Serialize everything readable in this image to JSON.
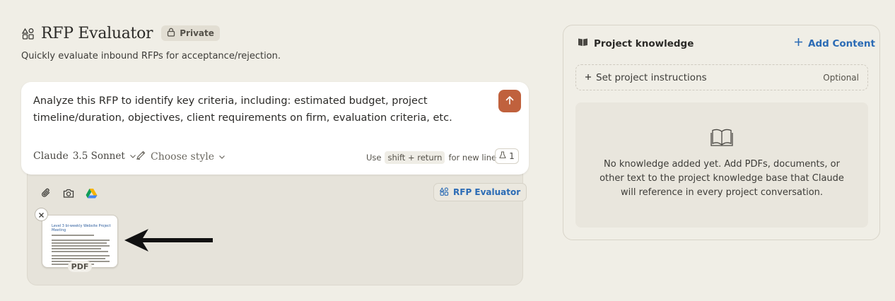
{
  "project": {
    "title": "RFP Evaluator",
    "visibility": "Private",
    "description": "Quickly evaluate inbound RFPs for acceptance/rejection."
  },
  "composer": {
    "prompt_line1": "Analyze this RFP to identify key criteria, including: estimated budget, project",
    "prompt_line2": "timeline/duration, objectives, client requirements on firm, evaluation criteria, etc.",
    "model_name": "Claude",
    "model_version": "3.5 Sonnet",
    "style_label": "Choose style",
    "hint_use": "Use",
    "hint_keys": "shift + return",
    "hint_suffix": "for new line",
    "attachment_count": "1",
    "accent_color": "#c0613d"
  },
  "toolbar": {
    "icons": [
      "paperclip-icon",
      "camera-icon",
      "google-drive-icon"
    ],
    "project_chip_label": "RFP Evaluator"
  },
  "attachment": {
    "type_label": "PDF",
    "preview_title": "Level 3 bi-weekly Website Project Meeting",
    "preview_meta": "Monday, Date, February 06, 2025, 00:00am"
  },
  "knowledge": {
    "header": "Project knowledge",
    "add_content_label": "Add Content",
    "instructions_label": "Set project instructions",
    "instructions_optional": "Optional",
    "empty_line1": "No knowledge added yet. Add PDFs, documents, or",
    "empty_line2": "other text to the project knowledge base that Claude",
    "empty_line3": "will reference in every project conversation.",
    "link_color": "#2b6bb5"
  }
}
